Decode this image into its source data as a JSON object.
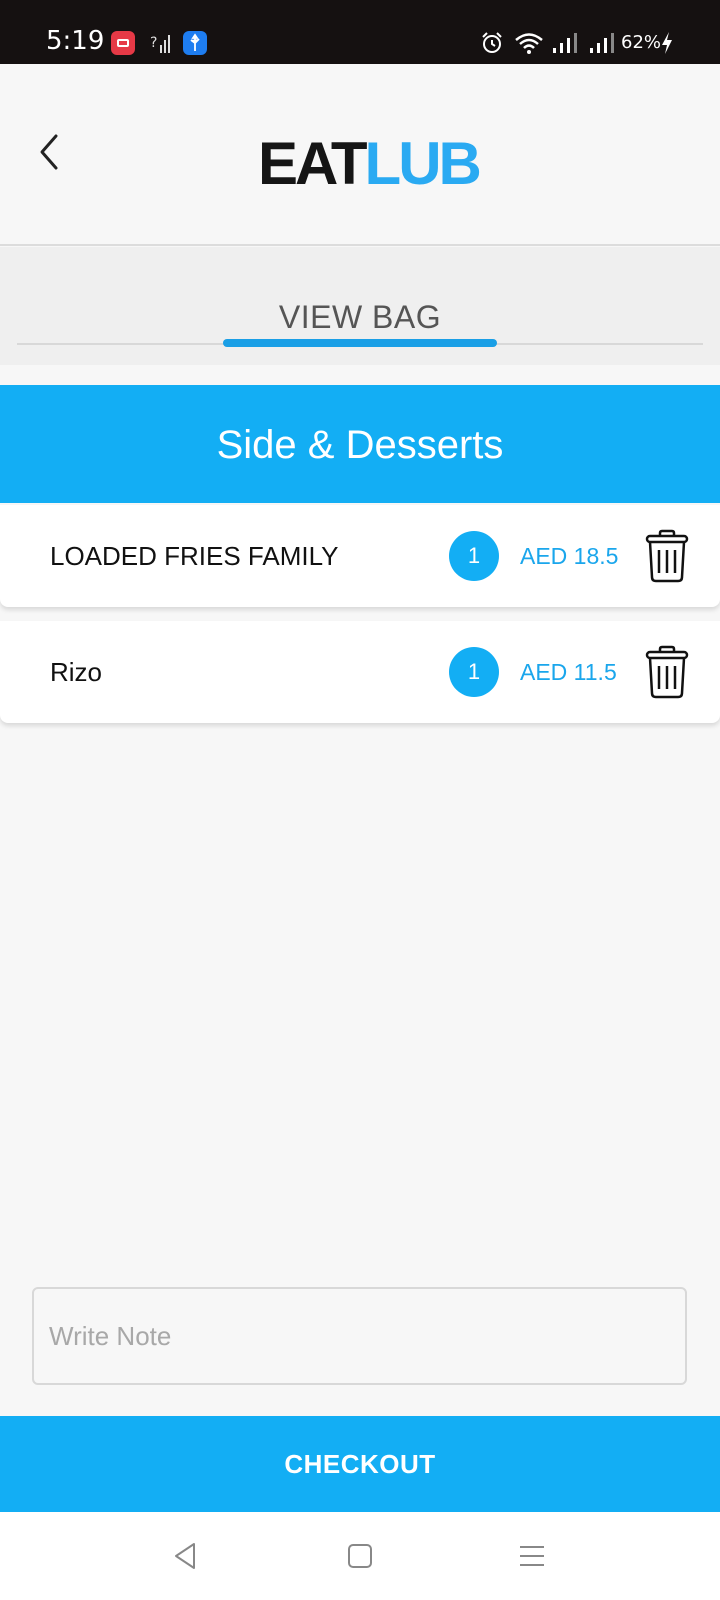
{
  "status_bar": {
    "time": "5:19",
    "battery": "62%",
    "icons": [
      "screen-record-icon",
      "no-signal-icon",
      "usb-icon",
      "alarm-icon",
      "wifi-icon",
      "signal-icon",
      "signal-icon",
      "charging-icon"
    ]
  },
  "header": {
    "logo_part1": "EAT",
    "logo_part2": "LUB",
    "back_icon": "chevron-left-icon",
    "logo_colors": {
      "part1": "#151515",
      "part2": "#2aaaf2"
    }
  },
  "tab": {
    "label": "VIEW BAG"
  },
  "category": {
    "title": "Side & Desserts"
  },
  "cart": {
    "items": [
      {
        "name": "LOADED FRIES FAMILY",
        "quantity": "1",
        "price": "AED 18.5"
      },
      {
        "name": "Rizo",
        "quantity": "1",
        "price": "AED 11.5"
      }
    ],
    "delete_icon": "trash-icon"
  },
  "note": {
    "placeholder": "Write Note",
    "value": ""
  },
  "checkout": {
    "label": "CHECKOUT"
  },
  "nav_bar": {
    "icons": [
      "back-triangle-icon",
      "home-square-icon",
      "recents-menu-icon"
    ]
  },
  "colors": {
    "accent": "#13aef4",
    "price_text": "#1aa6ec",
    "status_bar": "#151111",
    "background": "#f7f7f7"
  }
}
